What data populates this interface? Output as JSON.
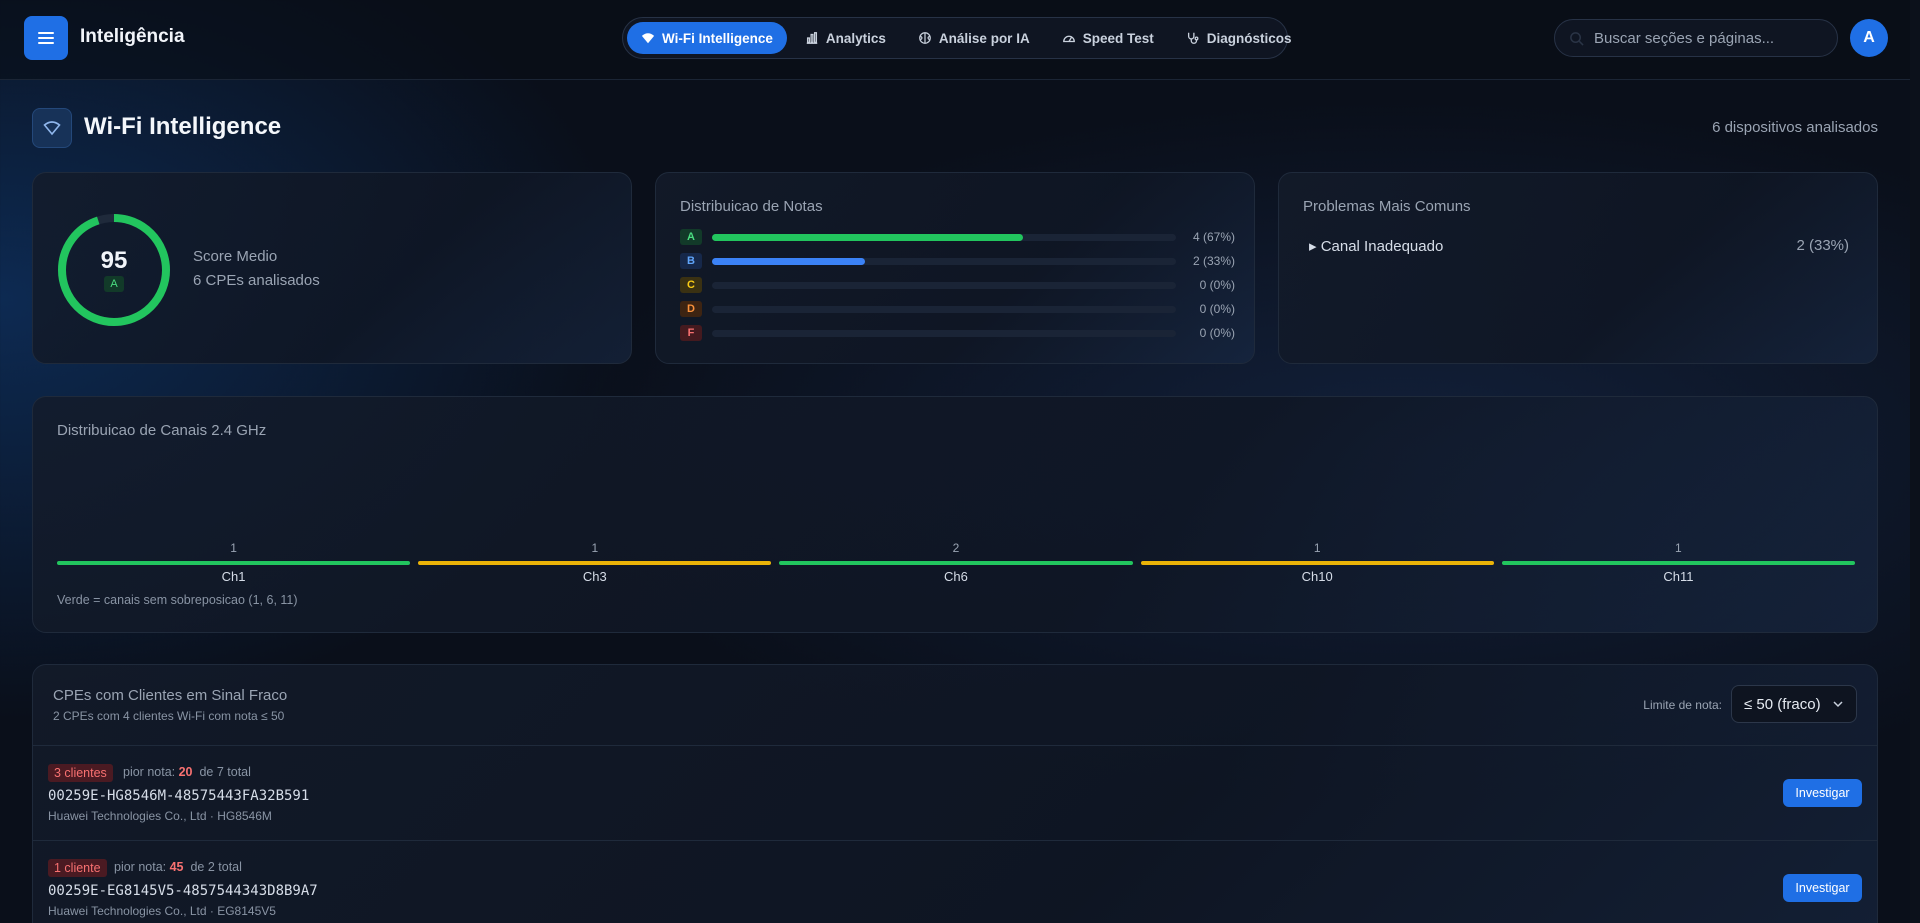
{
  "topbar": {
    "brand": "Inteligência",
    "tabs": [
      {
        "label": "Wi-Fi Intelligence",
        "icon": "wifi-icon",
        "active": true
      },
      {
        "label": "Analytics",
        "icon": "bar-chart-icon",
        "active": false
      },
      {
        "label": "Análise por IA",
        "icon": "brain-icon",
        "active": false
      },
      {
        "label": "Speed Test",
        "icon": "gauge-icon",
        "active": false
      },
      {
        "label": "Diagnósticos",
        "icon": "stethoscope-icon",
        "active": false
      }
    ],
    "search_placeholder": "Buscar seções e páginas...",
    "avatar_initial": "A"
  },
  "header": {
    "title": "Wi-Fi Intelligence",
    "devices_text": "6 dispositivos analisados"
  },
  "score": {
    "value": "95",
    "grade": "A",
    "label": "Score Medio",
    "count_text": "6 CPEs analisados",
    "progress": 0.95,
    "ring_color": "#22c55e"
  },
  "grades": {
    "title": "Distribuicao de Notas",
    "rows": [
      {
        "letter": "A",
        "fraction": 0.67,
        "text": "4 (67%)",
        "color": "#22c55e",
        "bg": "#123a29",
        "fg": "#4ade80"
      },
      {
        "letter": "B",
        "fraction": 0.33,
        "text": "2 (33%)",
        "color": "#3b82f6",
        "bg": "#16284a",
        "fg": "#60a5fa"
      },
      {
        "letter": "C",
        "fraction": 0,
        "text": "0 (0%)",
        "color": "#eab308",
        "bg": "#3a3112",
        "fg": "#facc15"
      },
      {
        "letter": "D",
        "fraction": 0,
        "text": "0 (0%)",
        "color": "#f97316",
        "bg": "#3d2412",
        "fg": "#fb923c"
      },
      {
        "letter": "F",
        "fraction": 0,
        "text": "0 (0%)",
        "color": "#ef4444",
        "bg": "#441a1f",
        "fg": "#f87171"
      }
    ]
  },
  "problems": {
    "title": "Problemas Mais Comuns",
    "items": [
      {
        "label": "▸ Canal Inadequado",
        "count": "2 (33%)"
      }
    ]
  },
  "channels": {
    "title": "Distribuicao de Canais 2.4 GHz",
    "note": "Verde = canais sem sobreposicao (1, 6, 11)",
    "colors": {
      "non_overlap": "#22c55e",
      "overlap": "#eab308"
    }
  },
  "chart_data": {
    "type": "bar",
    "title": "Distribuicao de Canais 2.4 GHz",
    "categories": [
      "Ch1",
      "Ch3",
      "Ch6",
      "Ch10",
      "Ch11"
    ],
    "values": [
      1,
      1,
      2,
      1,
      1
    ],
    "labels": [
      "1",
      "1",
      "2",
      "1",
      "1"
    ],
    "non_overlapping": [
      true,
      false,
      true,
      false,
      true
    ]
  },
  "weak": {
    "title": "CPEs com Clientes em Sinal Fraco",
    "subtitle": "2 CPEs com 4 clientes Wi-Fi com nota ≤ 50",
    "limit_label": "Limite de nota:",
    "limit_value": "≤ 50 (fraco)",
    "button_label": "Investigar",
    "rows": [
      {
        "badge": "3 clientes",
        "worst_label": "pior nota:",
        "worst_value": "20",
        "total_text": "de 7 total",
        "id": "00259E-HG8546M-48575443FA32B591",
        "vendor": "Huawei Technologies Co., Ltd · HG8546M"
      },
      {
        "badge": "1 cliente",
        "worst_label": "pior nota:",
        "worst_value": "45",
        "total_text": "de 2 total",
        "id": "00259E-EG8145V5-4857544343D8B9A7",
        "vendor": "Huawei Technologies Co., Ltd · EG8145V5"
      }
    ]
  }
}
